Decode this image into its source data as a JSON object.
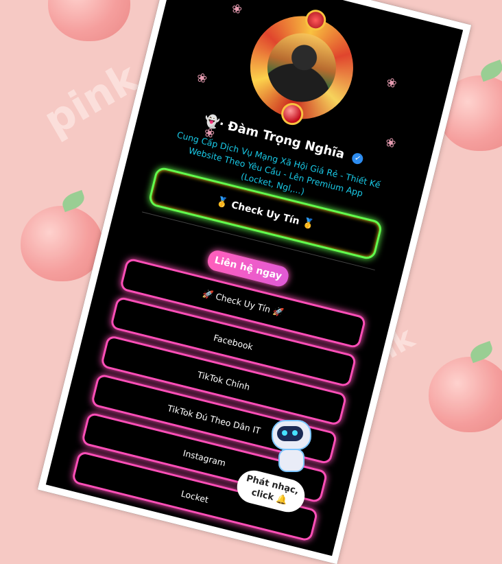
{
  "profile": {
    "name": "Đàm Trọng Nghĩa",
    "bio": "Cung Cấp Dịch Vụ Mạng Xã Hội Giá Rẻ - Thiết Kế Website Theo Yêu Cầu - Lên Premium App (Locket, Ngl,...)"
  },
  "check_uy_tin_label": "🥇 Check Uy Tín 🥇",
  "contact_label": "Liên hệ ngay",
  "links": [
    {
      "label": "🚀 Check Uy Tín 🚀"
    },
    {
      "label": "Facebook"
    },
    {
      "label": "TikTok Chính"
    },
    {
      "label": "TikTok Đú Theo Dân IT"
    },
    {
      "label": "Instagram"
    },
    {
      "label": "Locket"
    }
  ],
  "music_label": "Phát nhạc, click 🔔",
  "background_words": [
    "pink",
    "pink"
  ],
  "colors": {
    "page_bg": "#f6c9c4",
    "phone_bg": "#000000",
    "bio_text": "#19c9e6",
    "check_border": "#63ff4e",
    "link_border": "#ff4fb8",
    "contact_button": "#ff5fbb"
  }
}
